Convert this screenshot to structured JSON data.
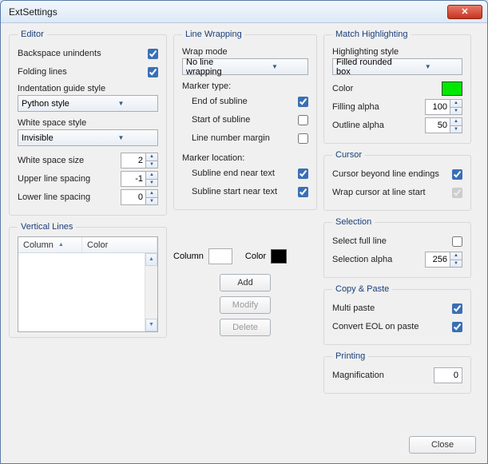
{
  "window": {
    "title": "ExtSettings"
  },
  "editor": {
    "legend": "Editor",
    "backspace_unindents": {
      "label": "Backspace unindents",
      "checked": true
    },
    "folding_lines": {
      "label": "Folding lines",
      "checked": true
    },
    "indent_guide_label": "Indentation guide style",
    "indent_guide_value": "Python style",
    "white_space_label": "White space style",
    "white_space_value": "Invisible",
    "white_space_size": {
      "label": "White space size",
      "value": "2"
    },
    "upper_spacing": {
      "label": "Upper line spacing",
      "value": "-1"
    },
    "lower_spacing": {
      "label": "Lower line spacing",
      "value": "0"
    }
  },
  "vertical_lines": {
    "legend": "Vertical Lines",
    "col_column": "Column",
    "col_color": "Color",
    "column_label": "Column",
    "color_label": "Color",
    "color_value": "#000000",
    "add": "Add",
    "modify": "Modify",
    "delete": "Delete"
  },
  "line_wrapping": {
    "legend": "Line Wrapping",
    "wrap_mode_label": "Wrap mode",
    "wrap_mode_value": "No line wrapping",
    "marker_type_label": "Marker type:",
    "end_of_subline": {
      "label": "End of subline",
      "checked": true
    },
    "start_of_subline": {
      "label": "Start of subline",
      "checked": false
    },
    "line_number_margin": {
      "label": "Line number margin",
      "checked": false
    },
    "marker_location_label": "Marker location:",
    "subline_end_near_text": {
      "label": "Subline end near text",
      "checked": true
    },
    "subline_start_near_text": {
      "label": "Subline start near text",
      "checked": true
    }
  },
  "match_highlighting": {
    "legend": "Match Highlighting",
    "style_label": "Highlighting style",
    "style_value": "Filled rounded box",
    "color_label": "Color",
    "color_value": "#00e800",
    "filling_alpha": {
      "label": "Filling alpha",
      "value": "100"
    },
    "outline_alpha": {
      "label": "Outline alpha",
      "value": "50"
    }
  },
  "cursor": {
    "legend": "Cursor",
    "beyond_line_endings": {
      "label": "Cursor beyond line endings",
      "checked": true
    },
    "wrap_cursor": {
      "label": "Wrap cursor at line start",
      "checked": true,
      "disabled": true
    }
  },
  "selection": {
    "legend": "Selection",
    "select_full_line": {
      "label": "Select full line",
      "checked": false
    },
    "selection_alpha": {
      "label": "Selection alpha",
      "value": "256"
    }
  },
  "copy_paste": {
    "legend": "Copy & Paste",
    "multi_paste": {
      "label": "Multi paste",
      "checked": true
    },
    "convert_eol": {
      "label": "Convert EOL on paste",
      "checked": true
    }
  },
  "printing": {
    "legend": "Printing",
    "magnification": {
      "label": "Magnification",
      "value": "0"
    }
  },
  "close": "Close"
}
